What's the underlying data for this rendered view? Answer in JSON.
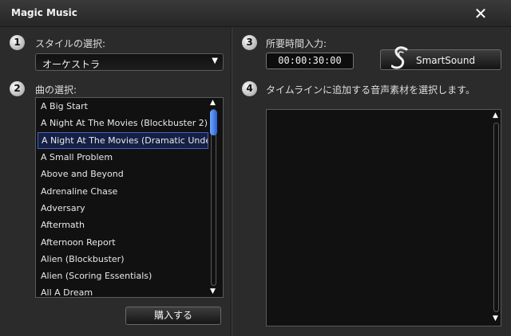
{
  "window": {
    "title": "Magic Music",
    "close_glyph": "✕"
  },
  "steps": [
    {
      "number": "1",
      "label": "スタイルの選択:"
    },
    {
      "number": "2",
      "label": "曲の選択:"
    },
    {
      "number": "3",
      "label": "所要時間入力:"
    },
    {
      "number": "4",
      "label": "タイムラインに追加する音声素材を選択します。"
    }
  ],
  "style_select": {
    "value": "オーケストラ",
    "arrow": "▼"
  },
  "song_list": {
    "items": [
      "A Big Start",
      "A Night At The Movies (Blockbuster 2)",
      "A Night At The Movies (Dramatic Undert",
      "A Small Problem",
      "Above and Beyond",
      "Adrenaline Chase",
      "Adversary",
      "Aftermath",
      "Afternoon Report",
      "Alien (Blockbuster)",
      "Alien (Scoring Essentials)",
      "All A Dream"
    ],
    "selected_index": 2,
    "scroll_up": "▲",
    "scroll_down": "▼"
  },
  "buy_button": {
    "label": "購入する"
  },
  "duration": {
    "value": "00:00:30:00"
  },
  "smartsound_button": {
    "label": "SmartSound",
    "icon": "smartsound-logo-icon"
  },
  "variation_panel": {
    "scroll_up": "▲",
    "scroll_down": "▼"
  },
  "colors": {
    "background": "#2b2b2b",
    "selection": "#152045",
    "selection_border": "#4a5fbf",
    "thumb": "#3f7fe8"
  }
}
